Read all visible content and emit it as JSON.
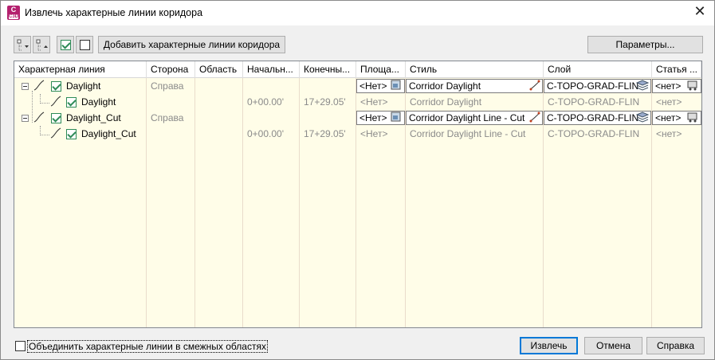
{
  "window": {
    "title": "Извлечь характерные линии коридора",
    "app_icon_top": "C",
    "app_icon_sub": "C3D",
    "close_glyph": "✕"
  },
  "toolbar": {
    "extract_button_label": "Добавить характерные линии коридора",
    "params_button_label": "Параметры..."
  },
  "grid": {
    "headers": [
      "Характерная линия",
      "Сторона",
      "Область",
      "Начальн...",
      "Конечны...",
      "Площа...",
      "Стиль",
      "Слой",
      "Статья ..."
    ],
    "rows": [
      {
        "name": "Daylight",
        "side": "Справа",
        "region": "",
        "start": "",
        "end": "",
        "site": "<Нет>",
        "style": "Corridor Daylight",
        "layer": "C-TOPO-GRAD-FLIN",
        "item": "<нет>",
        "level": 0,
        "editable": true
      },
      {
        "name": "Daylight",
        "side": "",
        "region": "",
        "start": "0+00.00'",
        "end": "17+29.05'",
        "site": "<Нет>",
        "style": "Corridor Daylight",
        "layer": "C-TOPO-GRAD-FLIN",
        "item": "<нет>",
        "level": 1,
        "editable": false
      },
      {
        "name": "Daylight_Cut",
        "side": "Справа",
        "region": "",
        "start": "",
        "end": "",
        "site": "<Нет>",
        "style": "Corridor Daylight Line - Cut",
        "layer": "C-TOPO-GRAD-FLIN",
        "item": "<нет>",
        "level": 0,
        "editable": true
      },
      {
        "name": "Daylight_Cut",
        "side": "",
        "region": "",
        "start": "0+00.00'",
        "end": "17+29.05'",
        "site": "<Нет>",
        "style": "Corridor Daylight Line - Cut",
        "layer": "C-TOPO-GRAD-FLIN",
        "item": "<нет>",
        "level": 1,
        "editable": false
      }
    ]
  },
  "footer": {
    "merge_label": "Объединить характерные линии в смежных областях",
    "extract_label": "Извлечь",
    "cancel_label": "Отмена",
    "help_label": "Справка"
  },
  "icons": [
    "app-icon",
    "close-icon",
    "expand-tree-icon",
    "collapse-tree-icon",
    "check-all-icon",
    "uncheck-all-icon",
    "featureline-icon",
    "site-picker-icon",
    "style-picker-icon",
    "layer-picker-icon",
    "pay-item-icon"
  ],
  "colors": {
    "grid_bg": "#fffde8",
    "check_green": "#2e8b57",
    "primary_border": "#0078d7",
    "disabled_text": "#8a8a8a"
  }
}
